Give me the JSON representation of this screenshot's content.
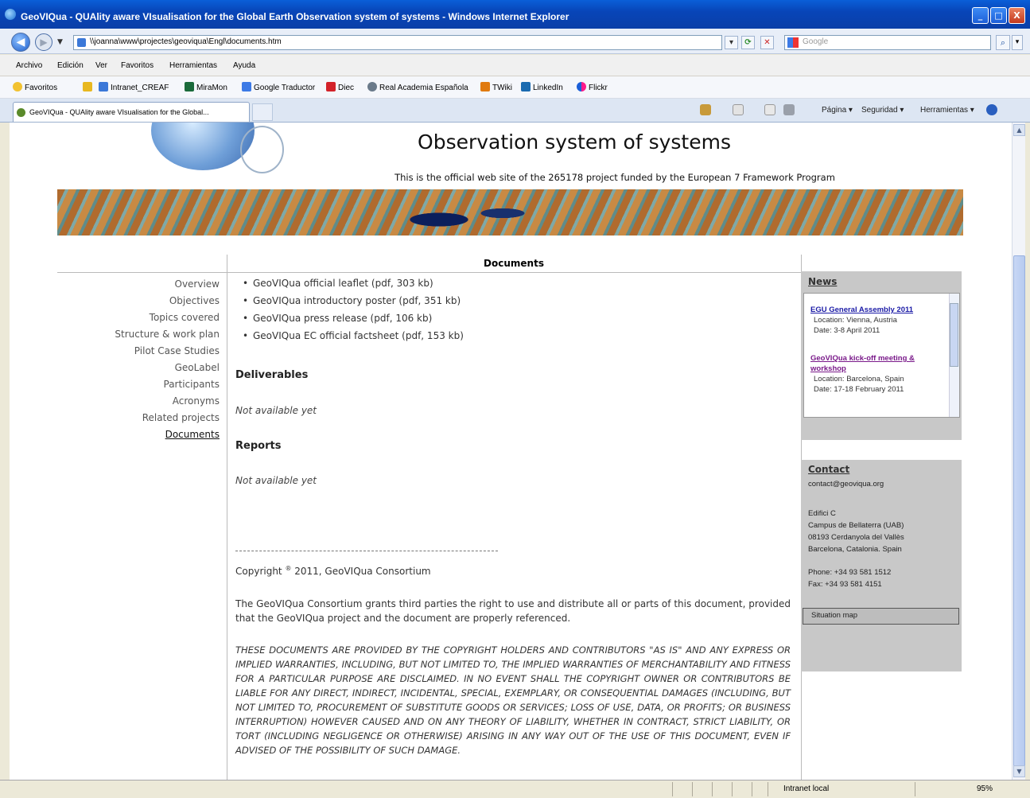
{
  "window": {
    "title": "GeoVIQua - QUAlity aware VIsualisation for the Global Earth Observation system of systems - Windows Internet Explorer",
    "min": "_",
    "max": "□",
    "close": "X"
  },
  "address": {
    "url": "\\\\joanna\\www\\projectes\\geoviqua\\Engl\\documents.htm",
    "search_placeholder": "Google"
  },
  "menu": [
    "Archivo",
    "Edición",
    "Ver",
    "Favoritos",
    "Herramientas",
    "Ayuda"
  ],
  "favorites": {
    "label": "Favoritos",
    "items": [
      "Intranet_CREAF",
      "MiraMon",
      "Google Traductor",
      "Diec",
      "Real Academia Española",
      "TWiki",
      "LinkedIn",
      "Flickr"
    ]
  },
  "tab": {
    "label": "GeoVIQua - QUAlity aware VIsualisation for the Global..."
  },
  "commands": {
    "page": "Página ▾",
    "security": "Seguridad ▾",
    "tools": "Herramientas ▾"
  },
  "header": {
    "title": "Observation system of systems",
    "subtitle": "This is the official web site of the 265178 project funded by the European 7 Framework Program"
  },
  "content_heading": "Documents",
  "nav": {
    "items": [
      "Overview",
      "Objectives",
      "Topics covered",
      "Structure & work plan",
      "Pilot Case Studies",
      "GeoLabel",
      "Participants",
      "Acronyms",
      "Related projects",
      "Documents"
    ]
  },
  "documents": [
    "GeoVIQua official leaflet (pdf, 303 kb)",
    "GeoVIQua introductory poster (pdf, 351 kb)",
    "GeoVIQua press release (pdf, 106 kb)",
    "GeoVIQua EC official factsheet (pdf, 153 kb)"
  ],
  "deliverables": {
    "title": "Deliverables",
    "text": "Not available yet"
  },
  "reports": {
    "title": "Reports",
    "text": "Not available yet"
  },
  "footer": {
    "copyright_pre": "Copyright ",
    "copyright_sym": "®",
    "copyright_post": " 2011, GeoVIQua Consortium",
    "grant": "The GeoVIQua Consortium grants third parties the right to use and distribute all or parts of this document, provided that the GeoVIQua project and the document are properly referenced.",
    "disclaimer": "THESE DOCUMENTS ARE PROVIDED BY THE COPYRIGHT HOLDERS AND CONTRIBUTORS \"AS IS\" AND ANY EXPRESS OR IMPLIED WARRANTIES, INCLUDING, BUT NOT LIMITED TO, THE IMPLIED WARRANTIES OF MERCHANTABILITY AND FITNESS FOR A PARTICULAR PURPOSE ARE DISCLAIMED. IN NO EVENT SHALL THE COPYRIGHT OWNER OR CONTRIBUTORS BE LIABLE FOR ANY DIRECT, INDIRECT, INCIDENTAL, SPECIAL, EXEMPLARY, OR CONSEQUENTIAL DAMAGES (INCLUDING, BUT NOT LIMITED TO, PROCUREMENT OF SUBSTITUTE GOODS OR SERVICES; LOSS OF USE, DATA, OR PROFITS; OR BUSINESS INTERRUPTION) HOWEVER CAUSED AND ON ANY THEORY OF LIABILITY, WHETHER IN CONTRACT, STRICT LIABILITY, OR TORT (INCLUDING NEGLIGENCE OR OTHERWISE) ARISING IN ANY WAY OUT OF THE USE OF THIS DOCUMENT, EVEN IF ADVISED OF THE POSSIBILITY OF SUCH DAMAGE."
  },
  "news": {
    "title": "News",
    "items": [
      {
        "link": "EGU General Assembly 2011",
        "location": "Location: Vienna, Austria",
        "date": "Date: 3-8 April 2011"
      },
      {
        "link": "GeoVIQua kick-off meeting & workshop",
        "location": "Location: Barcelona, Spain",
        "date": "Date: 17-18 February 2011"
      }
    ]
  },
  "contact": {
    "title": "Contact",
    "email": "contact@geoviqua.org",
    "address": [
      "Edifici C",
      "Campus de Bellaterra (UAB)",
      "08193 Cerdanyola del Vallès",
      "Barcelona, Catalonia. Spain"
    ],
    "phone": "Phone: +34 93 581 1512",
    "fax": "Fax: +34 93 581 4151",
    "map_button": "Situation map"
  },
  "status": {
    "zone": "Intranet local",
    "zoom": "95%"
  }
}
